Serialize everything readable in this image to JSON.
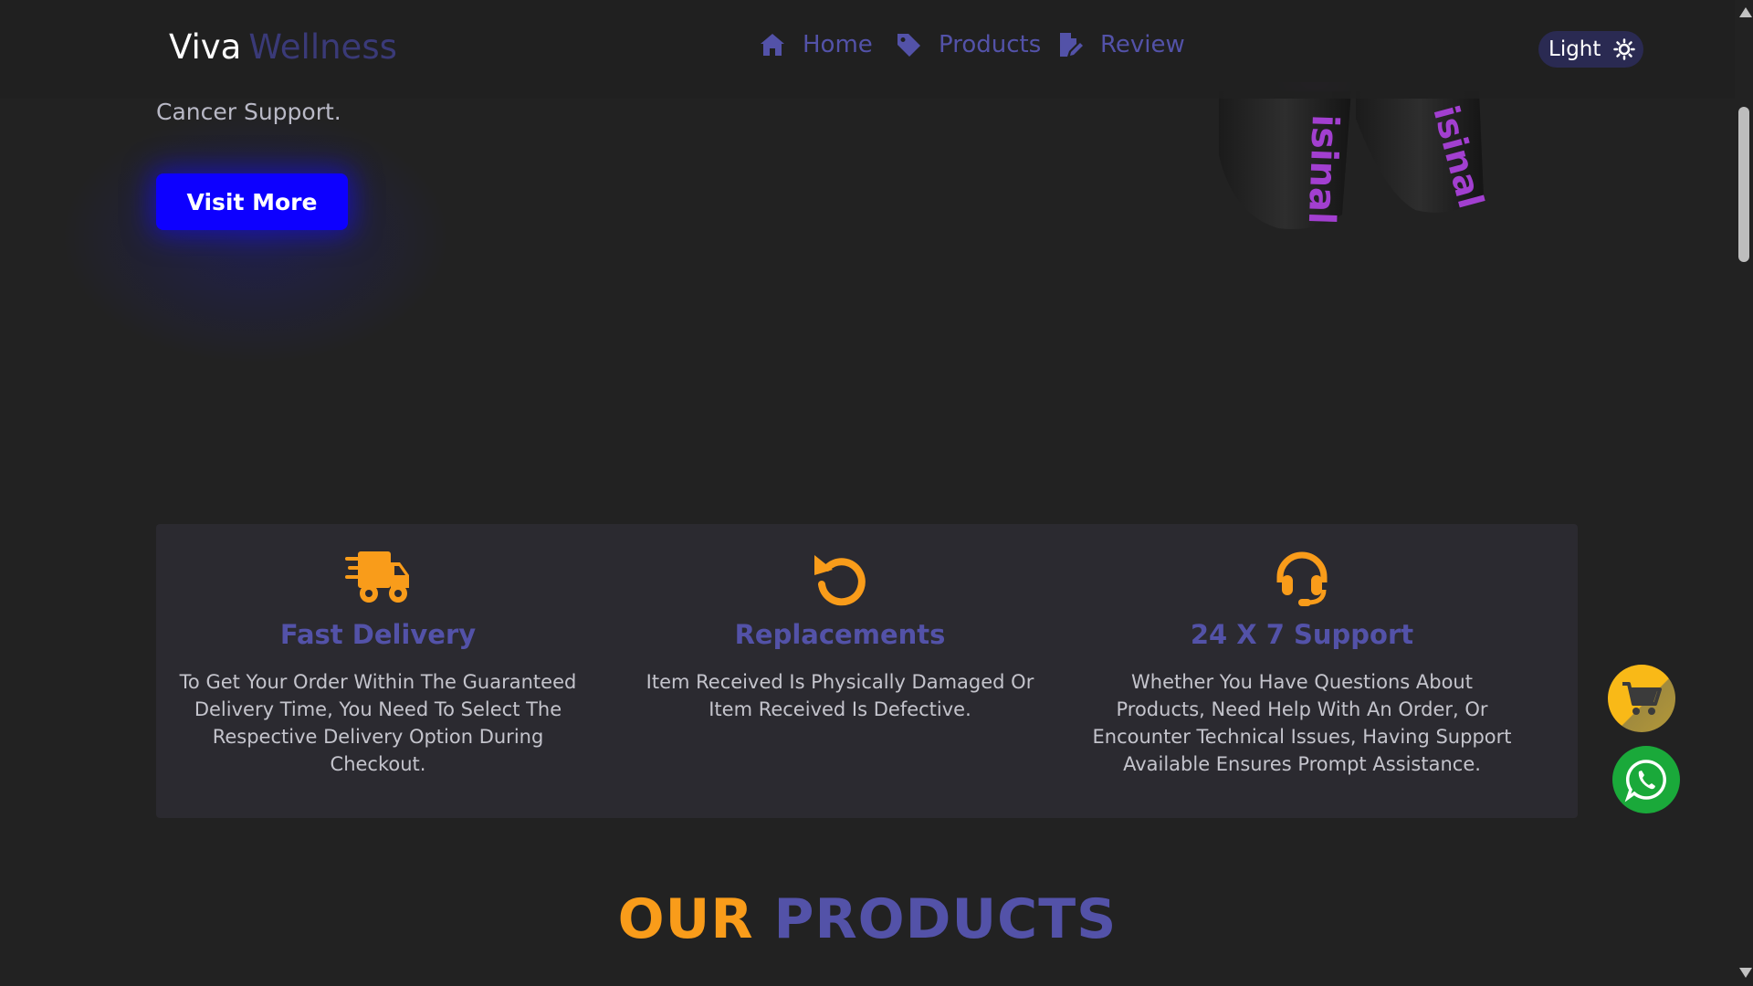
{
  "navbar": {
    "brand_main": "Viva",
    "brand_accent": "Wellness",
    "links": [
      {
        "label": "Home",
        "icon": "home-icon"
      },
      {
        "label": "Products",
        "icon": "tag-icon"
      },
      {
        "label": "Review",
        "icon": "file-signature-icon"
      }
    ],
    "theme_toggle": {
      "label": "Light",
      "icon": "sun-icon"
    }
  },
  "hero": {
    "text_fragment": "Cancer Support.",
    "button_label": "Visit More",
    "product_image_text": "isinal"
  },
  "features": [
    {
      "icon": "truck-fast-icon",
      "title": "Fast Delivery",
      "description": "To Get Your Order Within The Guaranteed Delivery Time, You Need To Select The Respective Delivery Option During Checkout."
    },
    {
      "icon": "rotate-left-icon",
      "title": "Replacements",
      "description": "Item Received Is Physically Damaged Or Item Received Is Defective."
    },
    {
      "icon": "headset-icon",
      "title": "24 X 7 Support",
      "description": "Whether You Have Questions About Products, Need Help With An Order, Or Encounter Technical Issues, Having Support Available Ensures Prompt Assistance."
    }
  ],
  "section_heading": {
    "word1": "OUR",
    "word2": "PRODUCTS"
  },
  "floating_buttons": [
    {
      "icon": "cart-icon"
    },
    {
      "icon": "whatsapp-icon"
    }
  ],
  "colors": {
    "background": "#222222",
    "brand_accent": "#5352a8",
    "orange": "#f99c1a",
    "button_blue": "#0d00ff",
    "whatsapp_green": "#1aa93a",
    "cart_yellow": "#f9b917"
  }
}
